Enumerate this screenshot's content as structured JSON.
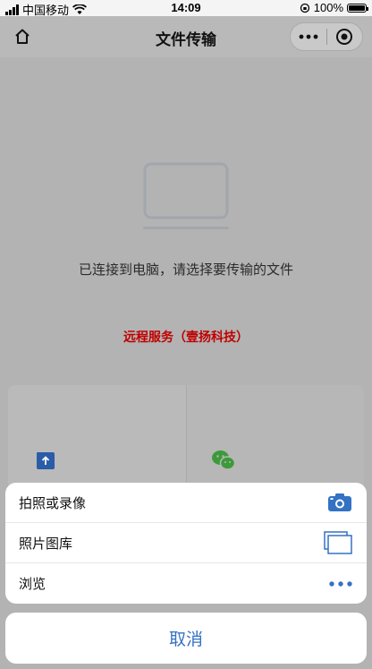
{
  "status_bar": {
    "carrier": "中国移动",
    "time": "14:09",
    "battery": "100%"
  },
  "header": {
    "title": "文件传输"
  },
  "content": {
    "status_text": "已连接到电脑，请选择要传输的文件",
    "watermark": "远程服务（壹扬科技）"
  },
  "action_sheet": {
    "items": [
      {
        "label": "拍照或录像",
        "icon": "camera-icon"
      },
      {
        "label": "照片图库",
        "icon": "photo-library-icon"
      },
      {
        "label": "浏览",
        "icon": "more-icon"
      }
    ],
    "cancel_label": "取消"
  },
  "colors": {
    "accent": "#3472c4",
    "watermark": "#c00000",
    "wechat_green": "#3d9a3a",
    "folder_blue": "#2a5ca8"
  }
}
